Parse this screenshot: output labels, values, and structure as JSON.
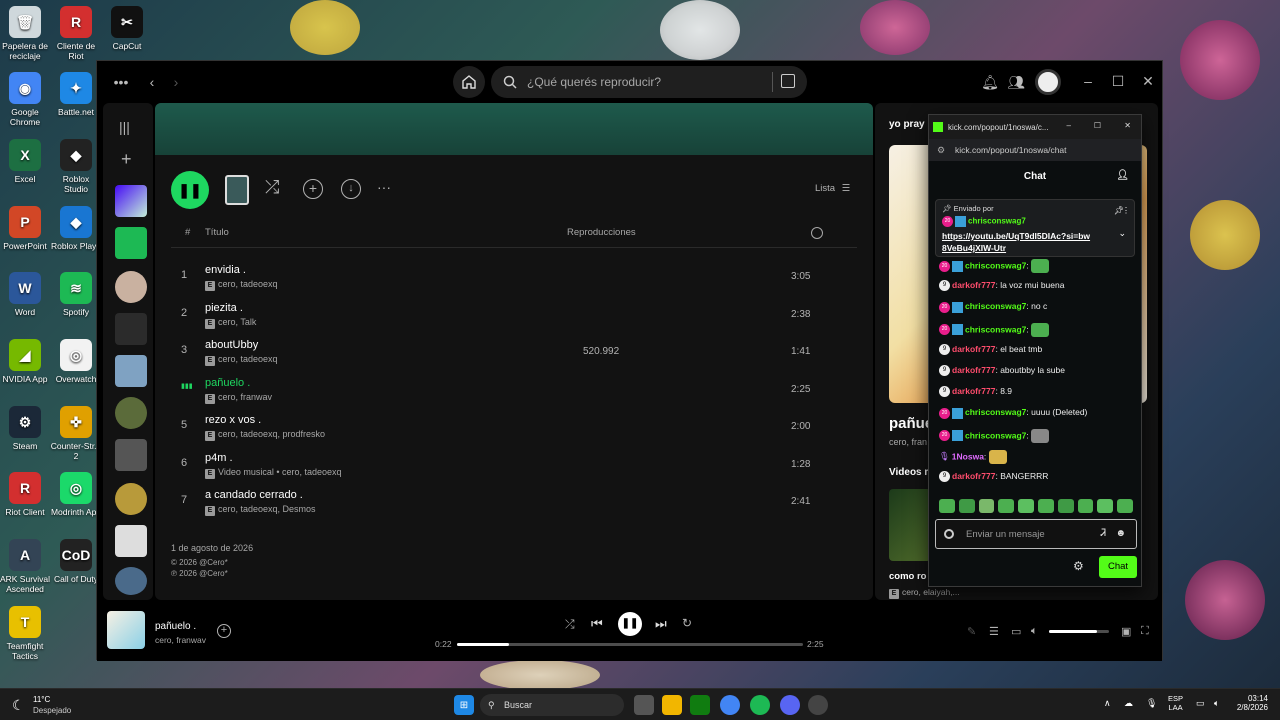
{
  "desktop": {
    "icons": [
      {
        "label": "Papelera de reciclaje",
        "glyph": "🗑"
      },
      {
        "label": "Cliente de Riot",
        "glyph": "R"
      },
      {
        "label": "CapCut",
        "glyph": "✂"
      },
      {
        "label": "Google Chrome",
        "glyph": "◉"
      },
      {
        "label": "Battle.net",
        "glyph": "✦"
      },
      {
        "label": "Excel",
        "glyph": "X"
      },
      {
        "label": "Roblox Studio",
        "glyph": "◆"
      },
      {
        "label": "PowerPoint",
        "glyph": "P"
      },
      {
        "label": "Roblox Playe",
        "glyph": "◆"
      },
      {
        "label": "Word",
        "glyph": "W"
      },
      {
        "label": "Spotify",
        "glyph": "≋"
      },
      {
        "label": "NVIDIA App",
        "glyph": "◢"
      },
      {
        "label": "Overwatch",
        "glyph": "◎"
      },
      {
        "label": "Steam",
        "glyph": "⚙"
      },
      {
        "label": "Counter-Str... 2",
        "glyph": "✜"
      },
      {
        "label": "Riot Client",
        "glyph": "R"
      },
      {
        "label": "Modrinth App",
        "glyph": "◎"
      },
      {
        "label": "ARK Survival Ascended",
        "glyph": "A"
      },
      {
        "label": "Call of Duty",
        "glyph": "CoD"
      },
      {
        "label": "Teamfight Tactics",
        "glyph": "T"
      }
    ]
  },
  "spotify": {
    "search_placeholder": "¿Qué querés reproducir?",
    "view_mode": "Lista",
    "col_number": "#",
    "col_title": "Título",
    "col_plays": "Reproducciones",
    "explicit_badge": "E",
    "tracks": [
      {
        "num": "1",
        "title": "envidia .",
        "artists": "cero, tadeoexq",
        "plays": "",
        "duration": "3:05"
      },
      {
        "num": "2",
        "title": "piezita .",
        "artists": "cero, Talk",
        "plays": "",
        "duration": "2:38"
      },
      {
        "num": "3",
        "title": "aboutUbby",
        "artists": "cero, tadeoexq",
        "plays": "520.992",
        "duration": "1:41"
      },
      {
        "num": "",
        "title": "pañuelo .",
        "artists": "cero, franwav",
        "plays": "",
        "duration": "2:25"
      },
      {
        "num": "5",
        "title": "rezo x vos .",
        "artists": "cero, tadeoexq, prodfresko",
        "plays": "",
        "duration": "2:00"
      },
      {
        "num": "6",
        "title": "p4m .",
        "artists": "Video musical • cero, tadeoexq",
        "plays": "",
        "duration": "1:28"
      },
      {
        "num": "7",
        "title": "a candado cerrado .",
        "artists": "cero, tadeoexq, Desmos",
        "plays": "",
        "duration": "2:41"
      }
    ],
    "release_date": "1 de agosto de 2026",
    "copyright_c": "© 2026 @Cero*",
    "copyright_p": "℗ 2026 @Cero*",
    "right_panel": {
      "heading": "yo pray .",
      "track_title": "pañue",
      "track_artist": "cero, fran",
      "videos_label": "Videos m",
      "next_title": "como ro",
      "next_artists": "cero, elaiyah,..."
    },
    "now_playing": {
      "title": "pañuelo .",
      "artist": "cero, franwav",
      "elapsed": "0:22",
      "total": "2:25",
      "progress": 0.15,
      "volume": 0.8
    },
    "accent": "#1ed760"
  },
  "kick": {
    "window_title": "kick.com/popout/1noswa/c...",
    "url": "kick.com/popout/1noswa/chat",
    "header": "Chat",
    "pinned_label": "Enviado por",
    "pinned_user": "chrisconswag7",
    "pinned_link": "https://youtu.be/UqT9dI5DIAc?si=bw8VeBu4jXIW-Utr",
    "messages": [
      {
        "badge": "sub",
        "user": "chrisconswag7",
        "color": "green",
        "text": ":",
        "emote": "#4caf50"
      },
      {
        "badge": "lvl",
        "user": "darkofr777",
        "color": "red",
        "text": ": la voz mui buena",
        "emote": ""
      },
      {
        "badge": "sub",
        "user": "chrisconswag7",
        "color": "green",
        "text": ": no c",
        "emote": ""
      },
      {
        "badge": "sub",
        "user": "chrisconswag7",
        "color": "green",
        "text": ":",
        "emote": "#4caf50"
      },
      {
        "badge": "lvl",
        "user": "darkofr777",
        "color": "red",
        "text": ": el beat tmb",
        "emote": ""
      },
      {
        "badge": "lvl",
        "user": "darkofr777",
        "color": "red",
        "text": ": aboutbby la sube",
        "emote": ""
      },
      {
        "badge": "lvl",
        "user": "darkofr777",
        "color": "red",
        "text": ": 8.9",
        "emote": ""
      },
      {
        "badge": "sub",
        "user": "chrisconswag7",
        "color": "green",
        "text": ": uuuu (Deleted)",
        "emote": ""
      },
      {
        "badge": "sub",
        "user": "chrisconswag7",
        "color": "green",
        "text": ":",
        "emote": "#888888"
      },
      {
        "badge": "mic",
        "user": "1Noswa",
        "color": "pink",
        "text": ":",
        "emote": "#d9b44a"
      },
      {
        "badge": "lvl",
        "user": "darkofr777",
        "color": "red",
        "text": ": BANGERRR",
        "emote": ""
      }
    ],
    "input_placeholder": "Enviar un mensaje",
    "send_label": "Chat",
    "accent": "#53fc18"
  },
  "taskbar": {
    "weather_temp": "11°C",
    "weather_desc": "Despejado",
    "search_label": "Buscar",
    "lang": "ESP",
    "layout": "LAA",
    "time": "03:14",
    "date": "2/8/2026"
  }
}
